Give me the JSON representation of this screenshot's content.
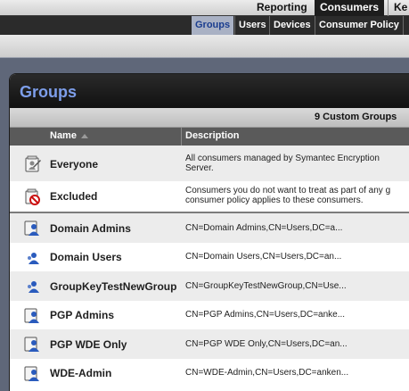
{
  "top_tabs": [
    {
      "label": "Reporting",
      "active": false
    },
    {
      "label": "Consumers",
      "active": true
    },
    {
      "label": "Ke",
      "active": false
    }
  ],
  "sub_tabs": [
    {
      "label": "Groups",
      "active": true
    },
    {
      "label": "Users",
      "active": false
    },
    {
      "label": "Devices",
      "active": false
    },
    {
      "label": "Consumer Policy",
      "active": false
    }
  ],
  "panel": {
    "title": "Groups",
    "count_label": "9 Custom Groups",
    "columns": {
      "name": "Name",
      "description": "Description"
    },
    "rows": [
      {
        "name": "Everyone",
        "description": "All consumers managed by Symantec Encryption\nServer.",
        "icon": "default-group-icon"
      },
      {
        "name": "Excluded",
        "description": "Consumers you do not want to treat as part of any g\nconsumer policy applies to these consumers.",
        "icon": "excluded-group-icon"
      },
      {
        "name": "Domain Admins",
        "description": "CN=Domain Admins,CN=Users,DC=a...",
        "icon": "ldap-group-icon"
      },
      {
        "name": "Domain Users",
        "description": "CN=Domain Users,CN=Users,DC=an...",
        "icon": "ldap-group-icon"
      },
      {
        "name": "GroupKeyTestNewGroup",
        "description": "CN=GroupKeyTestNewGroup,CN=Use...",
        "icon": "ldap-group-icon"
      },
      {
        "name": "PGP Admins",
        "description": "CN=PGP Admins,CN=Users,DC=anke...",
        "icon": "ldap-group-icon"
      },
      {
        "name": "PGP WDE Only",
        "description": "CN=PGP WDE Only,CN=Users,DC=an...",
        "icon": "ldap-group-icon"
      },
      {
        "name": "WDE-Admin",
        "description": "CN=WDE-Admin,CN=Users,DC=anken...",
        "icon": "ldap-group-icon"
      }
    ]
  },
  "colors": {
    "title_blue": "#7d9eea",
    "active_subtab_bg": "#a9b1c4",
    "page_bg": "#5f6779"
  }
}
